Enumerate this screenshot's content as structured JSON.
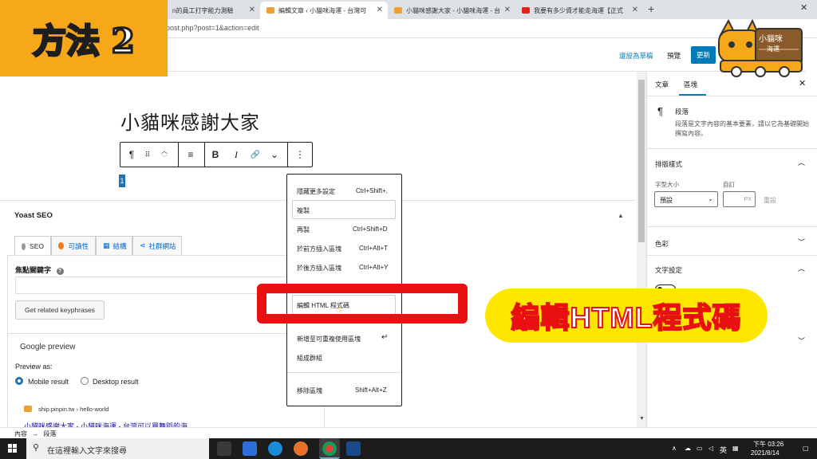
{
  "browser": {
    "tabs": [
      {
        "label": "n的員工打字能力測驗"
      },
      {
        "label": "編輯文章 ‹ 小貓咪海運 - 台灣可"
      },
      {
        "label": "小貓咪感謝大家 - 小貓咪海運 - 台"
      },
      {
        "label": "我要有多少資才能走海運【正式"
      }
    ],
    "new_tab": "+",
    "url": "post.php?post=1&action=edit"
  },
  "overlay": {
    "method_badge": "方法 2",
    "cta": "編輯HTML程式碼",
    "logo_text": "小貓咪",
    "logo_sub": "海運"
  },
  "wp_header": {
    "save_draft": "還設為草稿",
    "preview": "預覽",
    "update": "更新"
  },
  "editor": {
    "title": "小貓咪感謝大家",
    "selected_text": "1"
  },
  "toolbar": {
    "paragraph": "¶",
    "drag": "⠿",
    "align": "≡",
    "bold": "B",
    "italic": "I",
    "link": "🔗",
    "more_rich": "⌄",
    "options": "⋮"
  },
  "context_menu": {
    "items": [
      {
        "label": "隱藏更多設定",
        "shortcut": "Ctrl+Shift+,"
      },
      {
        "label": "複製",
        "shortcut": ""
      },
      {
        "label": "再製",
        "shortcut": "Ctrl+Shift+D"
      },
      {
        "label": "於前方插入區塊",
        "shortcut": "Ctrl+Alt+T"
      },
      {
        "label": "於後方插入區塊",
        "shortcut": "Ctrl+Alt+Y"
      },
      {
        "label": "編輯 HTML 程式碼",
        "shortcut": ""
      },
      {
        "label": "新增至可重複使用區塊",
        "shortcut": ""
      },
      {
        "label": "組成群組",
        "shortcut": ""
      },
      {
        "label": "移除區塊",
        "shortcut": "Shift+Alt+Z"
      }
    ]
  },
  "yoast": {
    "title": "Yoast SEO",
    "tabs": [
      {
        "label": "SEO"
      },
      {
        "label": "可讀性"
      },
      {
        "label": "結構"
      },
      {
        "label": "社群網站"
      }
    ],
    "focus_label": "焦點關鍵字",
    "related_button": "Get related keyphrases",
    "google_preview": "Google preview",
    "preview_as": "Preview as:",
    "mobile": "Mobile result",
    "desktop": "Desktop result",
    "snippet_url": "ship.pinpin.tw › hello-world",
    "snippet_title": "小貓咪感謝大家 - 小貓咪海運 - 台灣可以買舞蹈的海"
  },
  "sidebar": {
    "tab_post": "文章",
    "tab_block": "區塊",
    "block_name": "段落",
    "block_desc": "段落是文字內容的基本要素，請以它為基礎開始撰寫內容。",
    "typography": "排版樣式",
    "font_size_label": "字型大小",
    "custom_label": "自訂",
    "font_size_value": "預設",
    "custom_unit": "PX",
    "reset": "重設",
    "color": "色彩",
    "text_settings": "文字設定"
  },
  "breadcrumb": {
    "root": "內容",
    "arrow": "→",
    "current": "段落"
  },
  "taskbar": {
    "search_placeholder": "在這裡輸入文字來搜尋",
    "ime": "英",
    "time": "下午 03:26",
    "date": "2021/8/14"
  },
  "colors": {
    "wp_blue": "#007cba",
    "highlight_red": "#e81010",
    "banner_yellow": "#ffe600",
    "badge_orange": "#f7a81a"
  }
}
